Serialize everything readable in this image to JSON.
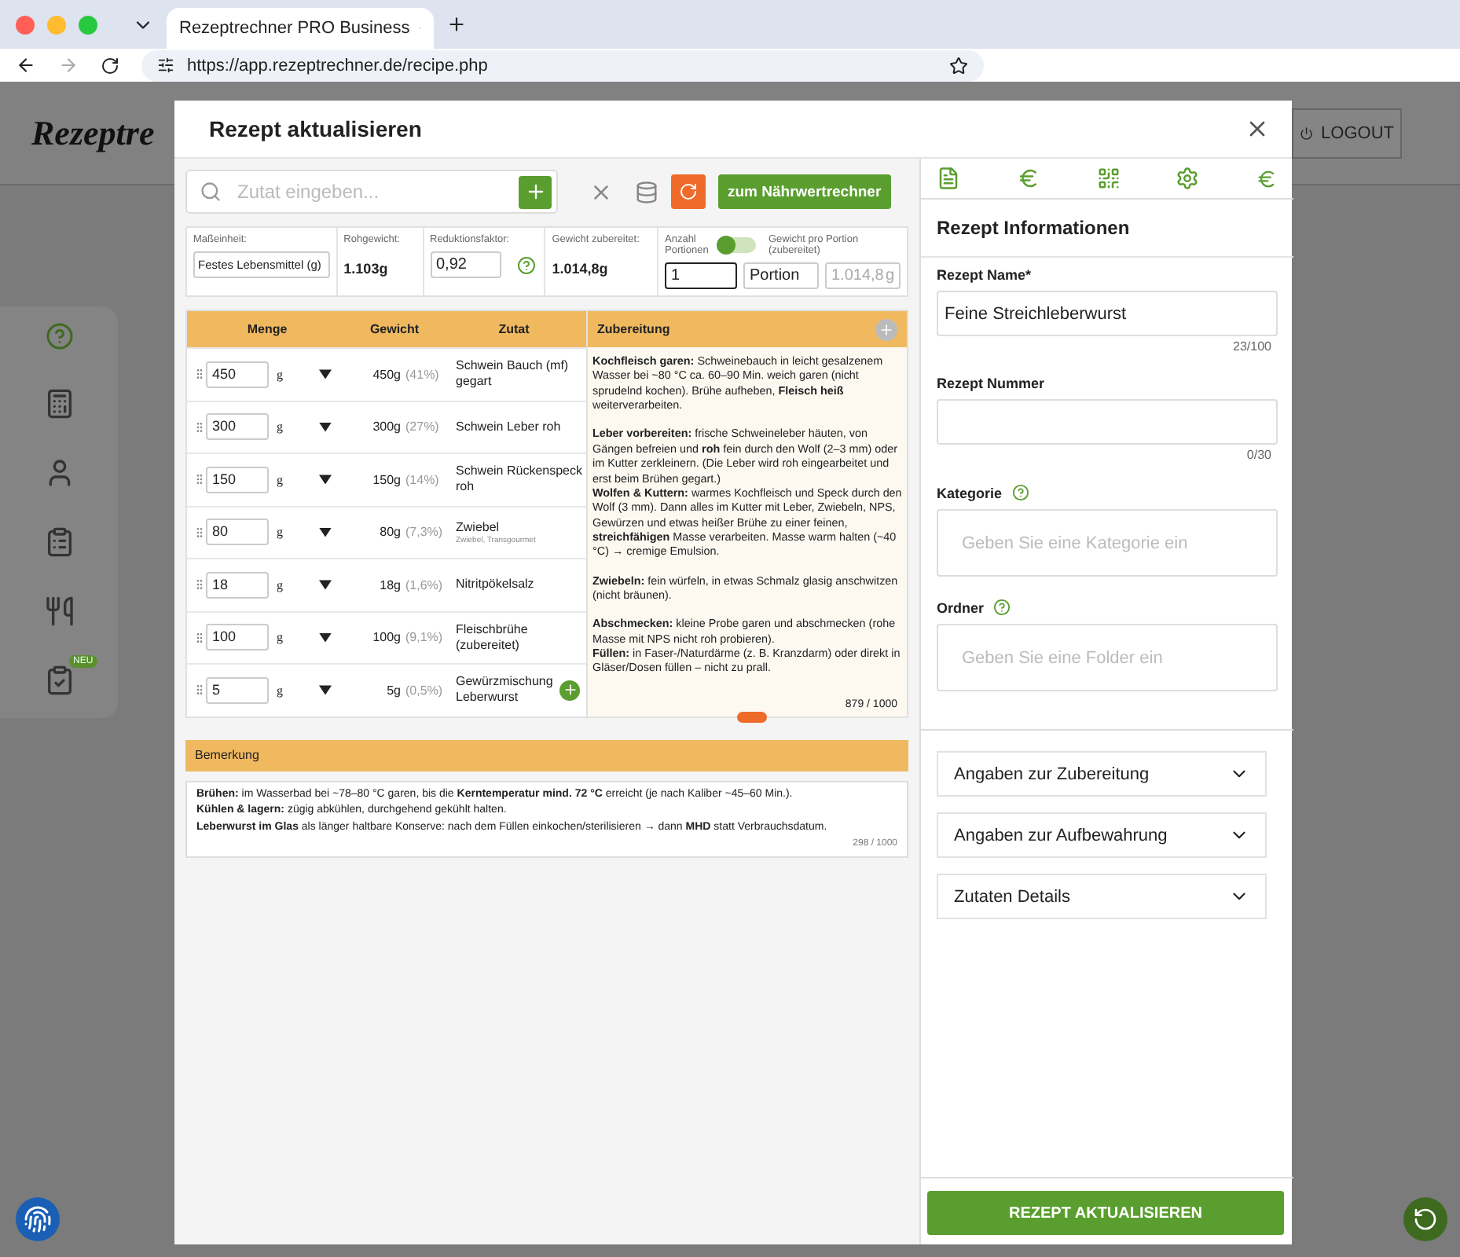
{
  "browser": {
    "tab_title": "Rezeptrechner PRO Business",
    "url": "https://app.rezeptrechner.de/recipe.php"
  },
  "page": {
    "logo_text": "Rezeptre",
    "logout": "LOGOUT",
    "sidebar_badge": "NEU"
  },
  "modal": {
    "title": "Rezept aktualisieren",
    "search": {
      "placeholder": "Zutat eingeben..."
    },
    "calculator_button": "zum Nährwertrechner",
    "settings": {
      "unit_label": "Maßeinheit:",
      "unit_value": "Festes Lebensmittel (g)",
      "raw_label": "Rohgewicht:",
      "raw_value": "1.103g",
      "reduction_label": "Reduktionsfaktor:",
      "reduction_value": "0,92",
      "cooked_label": "Gewicht zubereitet:",
      "cooked_value": "1.014,8g",
      "portions_label": "Anzahl Portionen",
      "portion_toggle_on": false,
      "per_portion_label": "Gewicht pro Portion (zubereitet)",
      "portions_value": "1",
      "portion_unit": "Portion",
      "per_portion_value": "1.014,8",
      "per_portion_unit": "g"
    },
    "table": {
      "columns": [
        "Menge",
        "Gewicht",
        "Zutat",
        "Zubereitung"
      ],
      "rows": [
        {
          "amount": "450",
          "unit": "g",
          "weight": "450g",
          "share": "(41%)",
          "name": "Schwein Bauch (mf) gegart"
        },
        {
          "amount": "300",
          "unit": "g",
          "weight": "300g",
          "share": "(27%)",
          "name": "Schwein Leber roh"
        },
        {
          "amount": "150",
          "unit": "g",
          "weight": "150g",
          "share": "(14%)",
          "name": "Schwein Rückenspeck roh"
        },
        {
          "amount": "80",
          "unit": "g",
          "weight": "80g",
          "share": "(7,3%)",
          "name": "Zwiebel",
          "source": "Zwiebel, Transgourmet"
        },
        {
          "amount": "18",
          "unit": "g",
          "weight": "18g",
          "share": "(1,6%)",
          "name": "Nitritpökelsalz"
        },
        {
          "amount": "100",
          "unit": "g",
          "weight": "100g",
          "share": "(9,1%)",
          "name": "Fleischbrühe (zubereitet)"
        },
        {
          "amount": "5",
          "unit": "g",
          "weight": "5g",
          "share": "(0,5%)",
          "name": "Gewürzmischung Leberwurst"
        }
      ],
      "preparation": [
        [
          "**Kochfleisch garen:** Schweinebauch in leicht gesalzenem Wasser bei ~80 °C ca. 60–90 Min. weich garen (nicht sprudelnd kochen). Brühe aufheben, **Fleisch heiß** weiterverarbeiten."
        ],
        [
          "**Leber vorbereiten:** frische Schweineleber häuten, von Gängen befreien und **roh** fein durch den Wolf (2–3 mm) oder im Kutter zerkleinern. (Die Leber wird roh eingearbeitet und erst beim Brühen gegart.)",
          "**Wolfen & Kuttern:** warmes Kochfleisch und Speck durch den Wolf (3 mm). Dann alles im Kutter mit Leber, Zwiebeln, NPS, Gewürzen und etwas heißer Brühe zu einer feinen, **streichfähigen** Masse verarbeiten. Masse warm halten (~40 °C) → cremige Emulsion."
        ],
        [
          "**Zwiebeln:** fein würfeln, in etwas Schmalz glasig anschwitzen (nicht bräunen)."
        ],
        [
          "**Abschmecken:** kleine Probe garen und abschmecken (rohe Masse mit NPS nicht roh probieren).",
          "**Füllen:** in Faser-/Naturdärme (z. B. Kranzdarm) oder direkt in Gläser/Dosen füllen – nicht zu prall."
        ]
      ],
      "preparation_count": "879 / 1000"
    },
    "remark": {
      "title": "Bemerkung",
      "lines": [
        "**Brühen:** im Wasserbad bei ~78–80 °C garen, bis die **Kerntemperatur mind. 72 °C** erreicht (je nach Kaliber ~45–60 Min.).",
        "**Kühlen & lagern:** zügig abkühlen, durchgehend gekühlt halten.",
        "**Leberwurst im Glas** als länger haltbare Konserve: nach dem Füllen einkochen/sterilisieren → dann **MHD** statt Verbrauchsdatum."
      ],
      "count": "298 / 1000"
    },
    "info": {
      "title": "Rezept Informationen",
      "fields": [
        {
          "label": "Rezept Name*",
          "value": "Feine Streichleberwurst",
          "counter": "23/100",
          "help": false
        },
        {
          "label": "Rezept Nummer",
          "counter": "0/30",
          "help": false
        },
        {
          "label": "Kategorie",
          "placeholder": "Geben Sie eine Kategorie ein",
          "help": true
        },
        {
          "label": "Ordner",
          "placeholder": "Geben Sie eine Folder ein",
          "help": true
        }
      ],
      "sections": [
        {
          "label": "Angaben zur Zubereitung",
          "expanded": false
        },
        {
          "label": "Angaben zur Aufbewahrung",
          "expanded": false
        },
        {
          "label": "Zutaten Details",
          "expanded": false
        }
      ],
      "submit": "REZEPT AKTUALISIEREN"
    }
  }
}
